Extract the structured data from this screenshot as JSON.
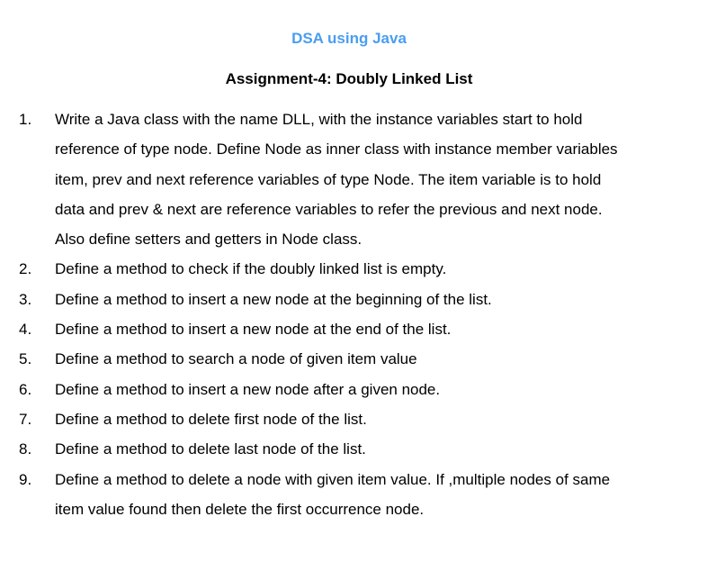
{
  "document": {
    "title": "DSA using Java",
    "subtitle": "Assignment-4: Doubly Linked List",
    "title_color": "#4a9df0",
    "items": [
      {
        "number": "1.",
        "lines": [
          "Write a Java class with the name DLL, with the instance variables start to hold",
          "reference of type node. Define Node as inner class with instance member variables",
          "item, prev and next reference variables of type Node. The item variable is to hold",
          "data and prev & next are reference variables to refer the previous and next node.",
          "Also define setters and getters in Node class."
        ]
      },
      {
        "number": "2.",
        "lines": [
          "Define a method to check if the doubly linked list is empty."
        ]
      },
      {
        "number": "3.",
        "lines": [
          "Define a method to insert a new node at the beginning of the list."
        ]
      },
      {
        "number": "4.",
        "lines": [
          "Define a method to insert a new node at the end of the list."
        ]
      },
      {
        "number": "5.",
        "lines": [
          "Define a method to search a node of given item value"
        ]
      },
      {
        "number": "6.",
        "lines": [
          "Define a method to insert a new node after a given node."
        ]
      },
      {
        "number": "7.",
        "lines": [
          "Define a method to delete first node of the list."
        ]
      },
      {
        "number": "8.",
        "lines": [
          "Define a method to delete last node of the list."
        ]
      },
      {
        "number": "9.",
        "lines": [
          "Define a method to delete a node with given item value. If ,multiple nodes of same",
          "item value found then delete the first occurrence node."
        ]
      }
    ]
  }
}
